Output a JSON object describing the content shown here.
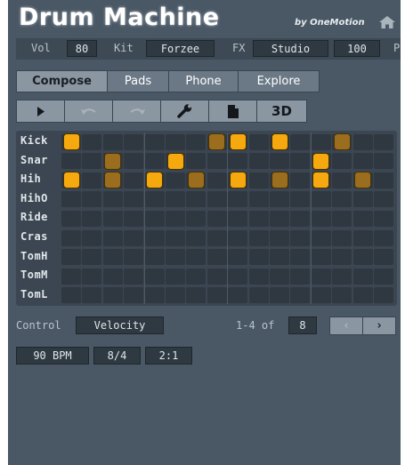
{
  "app": {
    "title": "Drum Machine",
    "byline": "by OneMotion"
  },
  "controls": {
    "vol_label": "Vol",
    "vol_value": "80",
    "kit_label": "Kit",
    "kit_value": "Forzee",
    "fx_label": "FX",
    "fx_value": "Studio",
    "fx_amount": "100",
    "p_label": "P"
  },
  "tabs": [
    {
      "label": "Compose",
      "active": true
    },
    {
      "label": "Pads",
      "active": false
    },
    {
      "label": "Phone",
      "active": false
    },
    {
      "label": "Explore",
      "active": false
    }
  ],
  "toolbar": {
    "play_icon": "play-icon",
    "undo_icon": "undo-icon",
    "redo_icon": "redo-icon",
    "settings_icon": "wrench-icon",
    "file_icon": "document-icon",
    "view_label": "3D"
  },
  "sequencer": {
    "rows": [
      {
        "label": "Kick",
        "notes": [
          {
            "step": 0,
            "level": "bright"
          },
          {
            "step": 7,
            "level": "dim"
          },
          {
            "step": 8,
            "level": "bright"
          },
          {
            "step": 10,
            "level": "bright"
          },
          {
            "step": 13,
            "level": "dim"
          }
        ]
      },
      {
        "label": "Snar",
        "notes": [
          {
            "step": 2,
            "level": "dim"
          },
          {
            "step": 5,
            "level": "bright"
          },
          {
            "step": 12,
            "level": "bright"
          }
        ]
      },
      {
        "label": "Hih",
        "notes": [
          {
            "step": 0,
            "level": "bright"
          },
          {
            "step": 2,
            "level": "dim"
          },
          {
            "step": 4,
            "level": "bright"
          },
          {
            "step": 6,
            "level": "dim"
          },
          {
            "step": 8,
            "level": "bright"
          },
          {
            "step": 10,
            "level": "dim"
          },
          {
            "step": 12,
            "level": "bright"
          },
          {
            "step": 14,
            "level": "dim"
          }
        ]
      },
      {
        "label": "HihO",
        "notes": []
      },
      {
        "label": "Ride",
        "notes": []
      },
      {
        "label": "Cras",
        "notes": []
      },
      {
        "label": "TomH",
        "notes": []
      },
      {
        "label": "TomM",
        "notes": []
      },
      {
        "label": "TomL",
        "notes": []
      }
    ],
    "steps": 16
  },
  "bottom": {
    "control_label": "Control",
    "control_value": "Velocity",
    "range_label": "1-4 of",
    "page_total": "8",
    "prev_icon": "chevron-left-icon",
    "next_icon": "chevron-right-icon"
  },
  "footer": {
    "bpm": "90 BPM",
    "signature": "8/4",
    "swing": "2:1"
  },
  "colors": {
    "background": "#4a5866",
    "note_bright": "#f6a90f",
    "note_dim": "#9a6d1f",
    "button": "#8a96a1"
  }
}
